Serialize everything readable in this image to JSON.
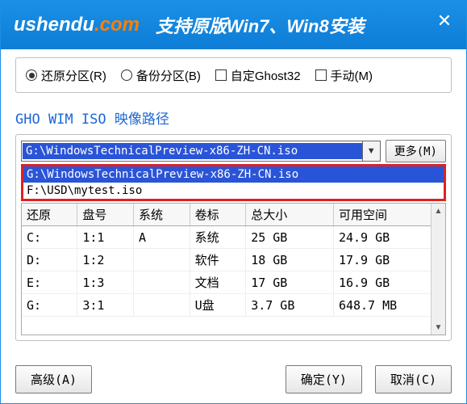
{
  "banner": "支持原版Win7、Win8安装",
  "logo_text": "ushendu",
  "logo_suffix": ".com",
  "modes": {
    "restore": "还原分区(R)",
    "backup": "备份分区(B)",
    "custom_ghost": "自定Ghost32",
    "manual": "手动(M)"
  },
  "section_label": "GHO WIM ISO 映像路径",
  "combo_selected": "G:\\WindowsTechnicalPreview-x86-ZH-CN.iso",
  "more_btn": "更多(M)",
  "dropdown": {
    "item_hl": "G:\\WindowsTechnicalPreview-x86-ZH-CN.iso",
    "item_2": "F:\\USD\\mytest.iso"
  },
  "table": {
    "headers": [
      "还原",
      "盘号",
      "系统",
      "卷标",
      "总大小",
      "可用空间"
    ],
    "rows": [
      {
        "drive": "C:",
        "disk": "1:1",
        "sys": "A",
        "label": "系统",
        "total": "25 GB",
        "free": "24.9 GB"
      },
      {
        "drive": "D:",
        "disk": "1:2",
        "sys": "",
        "label": "软件",
        "total": "18 GB",
        "free": "17.9 GB"
      },
      {
        "drive": "E:",
        "disk": "1:3",
        "sys": "",
        "label": "文档",
        "total": "17 GB",
        "free": "16.9 GB"
      },
      {
        "drive": "G:",
        "disk": "3:1",
        "sys": "",
        "label": "U盘",
        "total": "3.7 GB",
        "free": "648.7 MB"
      }
    ]
  },
  "buttons": {
    "advanced": "高级(A)",
    "ok": "确定(Y)",
    "cancel": "取消(C)"
  }
}
